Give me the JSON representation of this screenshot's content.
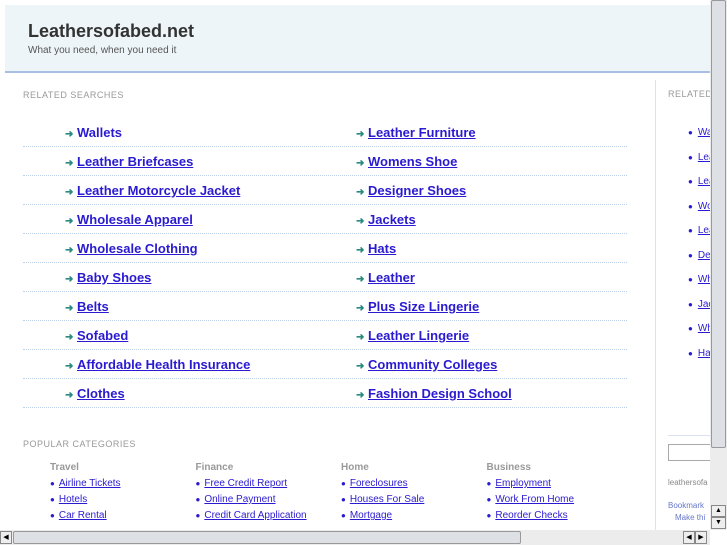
{
  "header": {
    "title": "Leathersofabed.net",
    "tagline": "What you need, when you need it"
  },
  "related": {
    "label": "RELATED SEARCHES",
    "left": [
      "Wallets",
      "Leather Briefcases",
      "Leather Motorcycle Jacket",
      "Wholesale Apparel",
      "Wholesale Clothing",
      "Baby Shoes",
      "Belts",
      "Sofabed",
      "Affordable Health Insurance",
      "Clothes"
    ],
    "right": [
      "Leather Furniture",
      "Womens Shoe",
      "Designer Shoes",
      "Jackets",
      "Hats",
      "Leather",
      "Plus Size Lingerie",
      "Leather Lingerie",
      "Community Colleges",
      "Fashion Design School"
    ]
  },
  "popular": {
    "label": "POPULAR CATEGORIES",
    "columns": [
      {
        "title": "Travel",
        "links": [
          "Airline Tickets",
          "Hotels",
          "Car Rental"
        ]
      },
      {
        "title": "Finance",
        "links": [
          "Free Credit Report",
          "Online Payment",
          "Credit Card Application"
        ]
      },
      {
        "title": "Home",
        "links": [
          "Foreclosures",
          "Houses For Sale",
          "Mortgage"
        ]
      },
      {
        "title": "Business",
        "links": [
          "Employment",
          "Work From Home",
          "Reorder Checks"
        ]
      }
    ]
  },
  "sidebar": {
    "label": "RELATED",
    "links": [
      "Wa",
      "Lea",
      "Lea",
      "Wo",
      "Lea",
      "De",
      "Wh",
      "Jac",
      "Wh",
      "Ha"
    ],
    "domain_text": "leathersofa",
    "bookmark": "Bookmark",
    "make": "Make thi"
  },
  "colors": {
    "link": "#2a1ad0",
    "arrow": "#2a8a80",
    "header_bg": "#eef5f8"
  }
}
